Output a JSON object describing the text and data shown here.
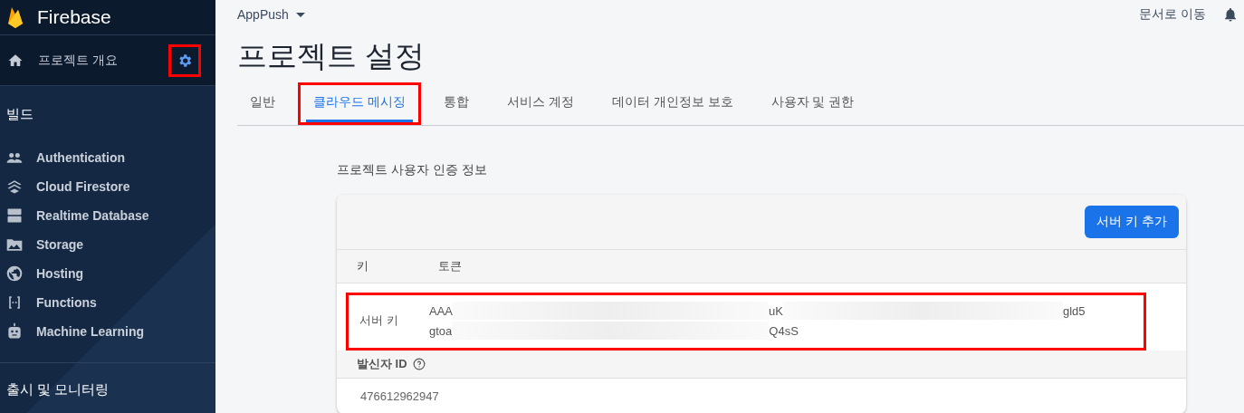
{
  "sidebar": {
    "brand": "Firebase",
    "overview": {
      "label": "프로젝트 개요",
      "settings_highlighted": true
    },
    "sections": [
      {
        "title": "빌드",
        "items": [
          {
            "label": "Authentication"
          },
          {
            "label": "Cloud Firestore"
          },
          {
            "label": "Realtime Database"
          },
          {
            "label": "Storage"
          },
          {
            "label": "Hosting"
          },
          {
            "label": "Functions"
          },
          {
            "label": "Machine Learning"
          }
        ]
      },
      {
        "title": "출시 및 모니터링"
      }
    ]
  },
  "topbar": {
    "project": "AppPush",
    "docs_link": "문서로 이동"
  },
  "page_title": "프로젝트 설정",
  "tabs": [
    {
      "label": "일반",
      "selected": false,
      "highlighted": false
    },
    {
      "label": "클라우드 메시징",
      "selected": true,
      "highlighted": true
    },
    {
      "label": "통합",
      "selected": false,
      "highlighted": false
    },
    {
      "label": "서비스 계정",
      "selected": false,
      "highlighted": false
    },
    {
      "label": "데이터 개인정보 보호",
      "selected": false,
      "highlighted": false
    },
    {
      "label": "사용자 및 권한",
      "selected": false,
      "highlighted": false
    }
  ],
  "credentials": {
    "heading": "프로젝트 사용자 인증 정보",
    "add_button": "서버 키 추가",
    "columns": [
      "키",
      "토큰"
    ],
    "rows": [
      {
        "key": "서버 키",
        "highlighted": true,
        "token_lines": [
          [
            {
              "kind": "text",
              "text": "AAA"
            },
            {
              "kind": "redacted"
            },
            {
              "kind": "text",
              "text": "uK"
            },
            {
              "kind": "redacted"
            },
            {
              "kind": "text",
              "text": "gld5"
            }
          ],
          [
            {
              "kind": "text",
              "text": "gtoa"
            },
            {
              "kind": "redacted"
            },
            {
              "kind": "text",
              "text": "Q4sS"
            }
          ]
        ]
      }
    ],
    "sender_id_label": "발신자 ID",
    "sender_id": "476612962947"
  }
}
